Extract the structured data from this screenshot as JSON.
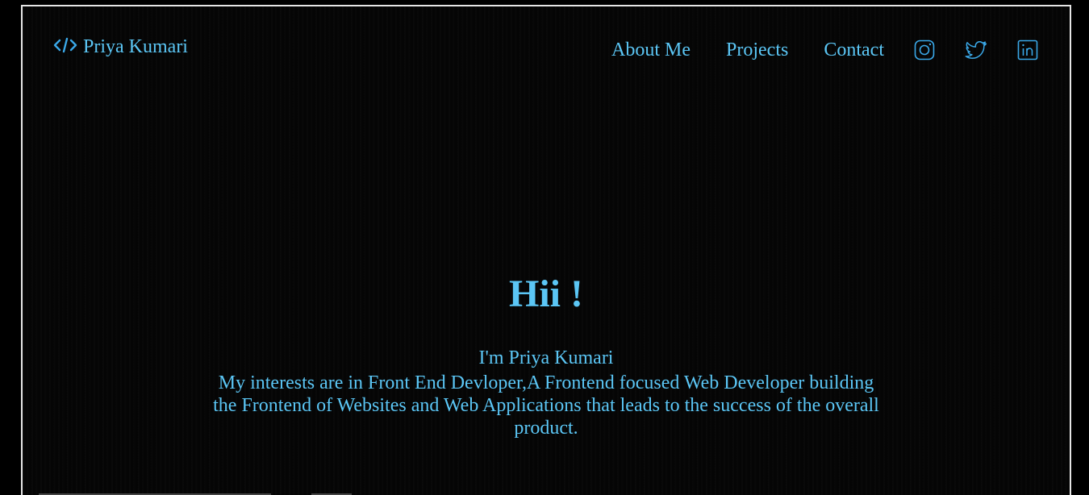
{
  "header": {
    "logo_text": "Priya Kumari",
    "logo_icon": "code-icon"
  },
  "nav": {
    "items": [
      {
        "label": "About Me"
      },
      {
        "label": "Projects"
      },
      {
        "label": "Contact"
      }
    ],
    "social": [
      {
        "icon": "instagram-icon"
      },
      {
        "icon": "twitter-icon"
      },
      {
        "icon": "linkedin-icon"
      }
    ]
  },
  "hero": {
    "title": "Hii !",
    "intro": "I'm Priya Kumari",
    "description": "My interests are in Front End Devloper,A Frontend focused Web Developer building the Frontend of Websites and Web Applications that leads to the success of the overall product."
  },
  "colors": {
    "accent": "#5bc6f5",
    "background": "#000000",
    "frame_border": "#e6e6e6"
  }
}
